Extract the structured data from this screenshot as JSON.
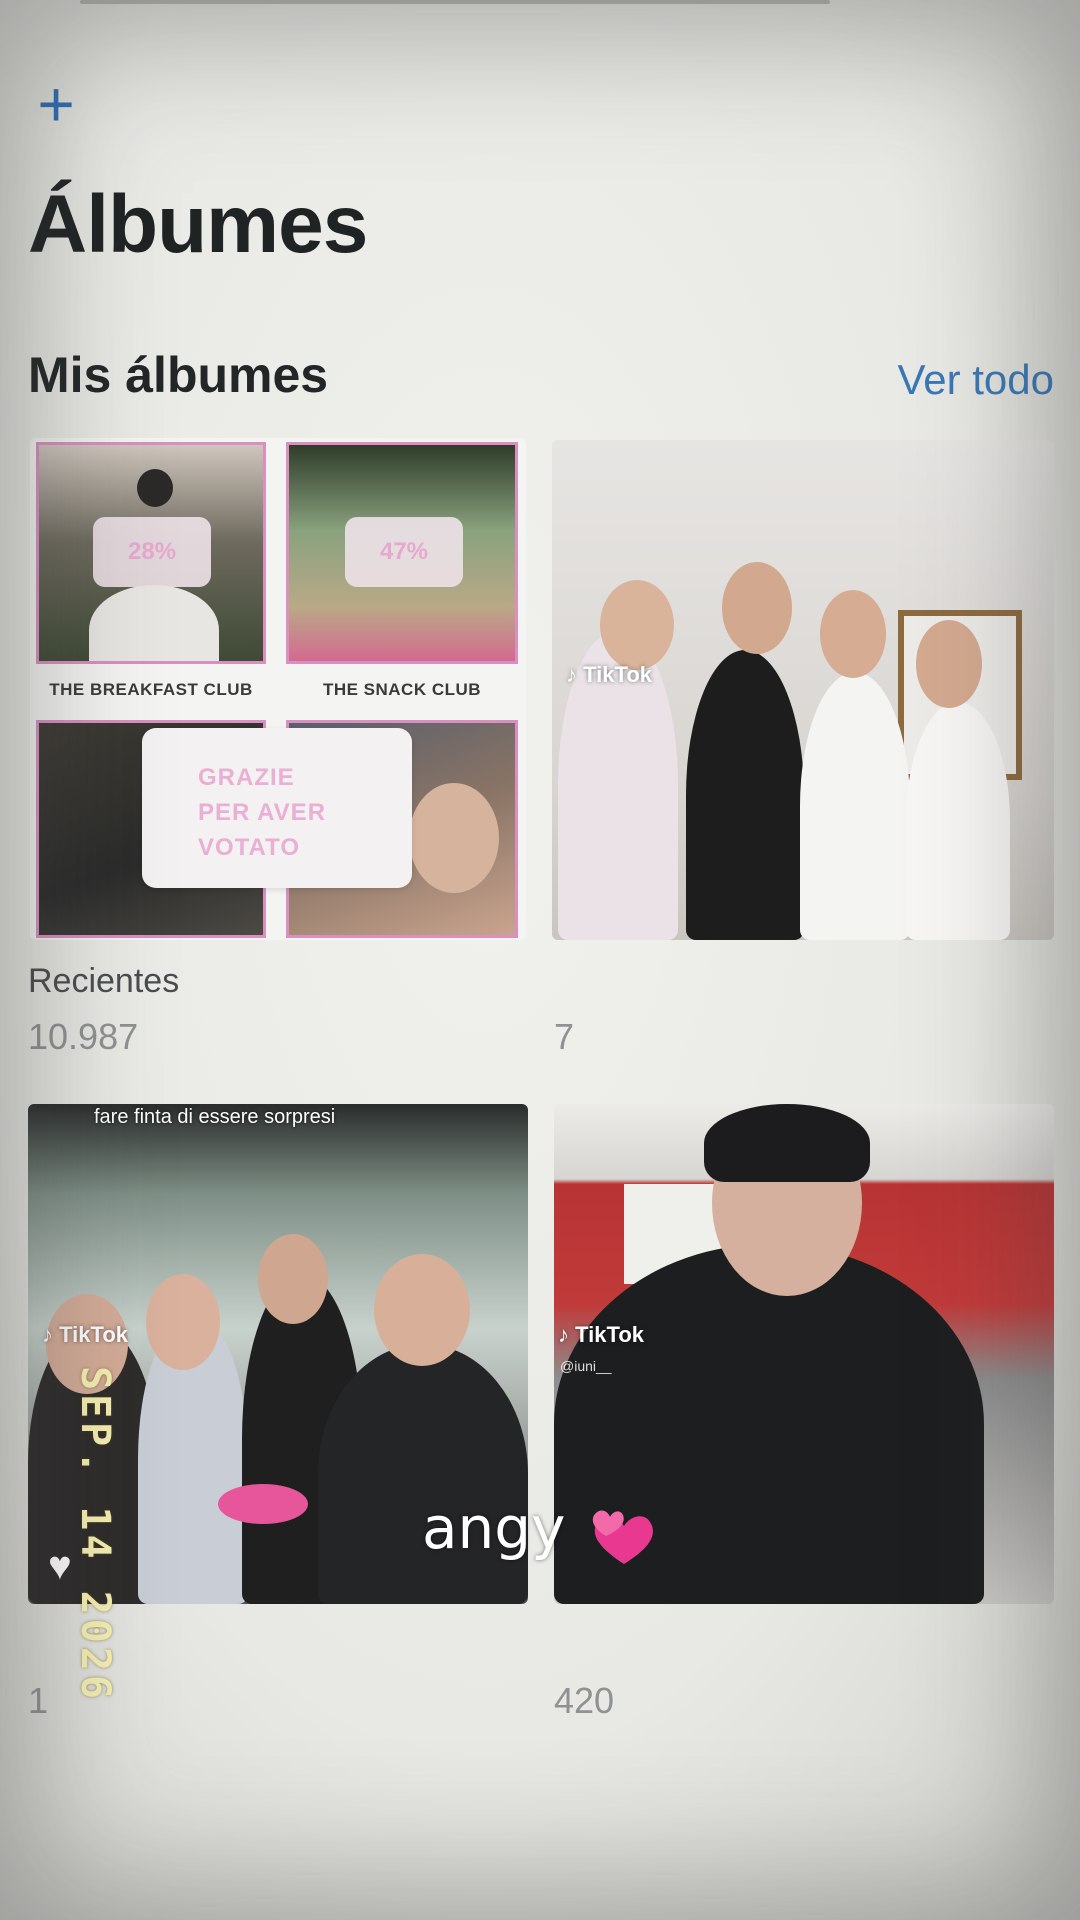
{
  "header": {
    "add_icon": "plus-icon",
    "title": "Álbumes"
  },
  "section": {
    "title": "Mis álbumes",
    "see_all": "Ver todo"
  },
  "albums": [
    {
      "name": "Recientes",
      "count": "10.987",
      "collage": {
        "tile_captions": [
          "THE BREAKFAST CLUB",
          "THE SNACK CLUB"
        ],
        "badges": [
          "28%",
          "47%"
        ],
        "card_lines": [
          "GRAZIE",
          "PER AVER",
          "VOTATO"
        ]
      }
    },
    {
      "name": "",
      "count": "7",
      "watermark": "TikTok"
    },
    {
      "name": "",
      "count": "1",
      "watermark": "TikTok",
      "overlay_text": "fare finta di essere sorpresi"
    },
    {
      "name": "",
      "count": "420",
      "watermark": "TikTok",
      "handle": "@iuni__"
    }
  ],
  "stamp": {
    "date": "SEP. 14 2026",
    "sticker_text": "angy",
    "sticker_icon": "hearts-icon"
  },
  "colors": {
    "accent_blue": "#3a78b6",
    "collage_pink": "#d98fc0",
    "stamp_yellow": "#f6efb3"
  }
}
